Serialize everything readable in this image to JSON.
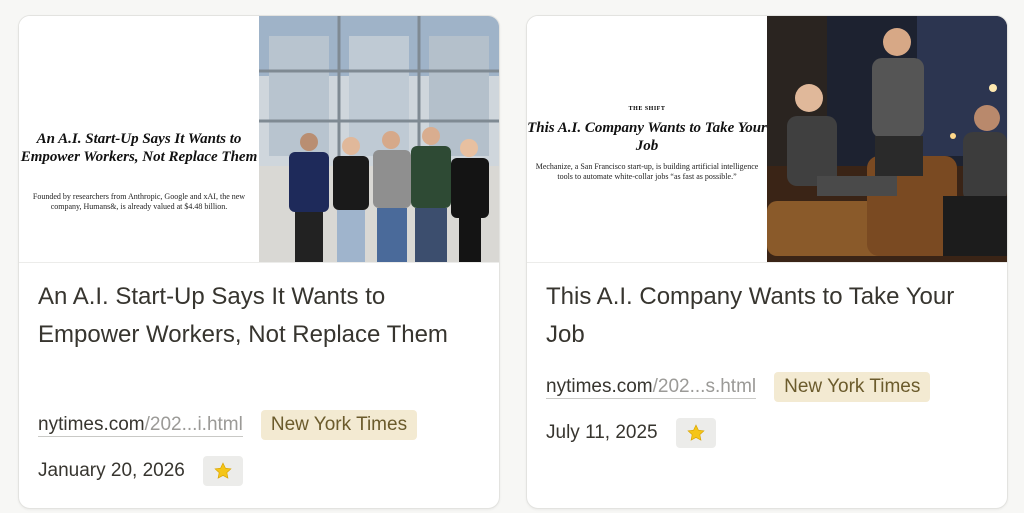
{
  "cards": [
    {
      "thumbnail": {
        "kicker": "",
        "headline": "An A.I. Start-Up Says It Wants to Empower Workers, Not Replace Them",
        "summary": "Founded by researchers from Anthropic, Google and xAI, the new company, Humans&, is already valued at $4.48 billion."
      },
      "title": "An A.I. Start-Up Says It Wants to Empower Workers, Not Replace Them",
      "url_domain": "nytimes.com",
      "url_path": "/202...i.html",
      "source_tag": "New York Times",
      "date": "January 20, 2026",
      "favorite_icon": "star-icon"
    },
    {
      "thumbnail": {
        "kicker": "THE SHIFT",
        "headline": "This A.I. Company Wants to Take Your Job",
        "summary": "Mechanize, a San Francisco start-up, is building artificial intelligence tools to automate white-collar jobs “as fast as possible.”"
      },
      "title": "This A.I. Company Wants to Take Your Job",
      "url_domain": "nytimes.com",
      "url_path": "/202...s.html",
      "source_tag": "New York Times",
      "date": "July 11, 2025",
      "favorite_icon": "star-icon"
    }
  ],
  "colors": {
    "tag_bg": "#f3ead2",
    "tag_text": "#6b5b2c",
    "text": "#37352f",
    "muted": "#9b9a97",
    "star": "#f5c518"
  }
}
